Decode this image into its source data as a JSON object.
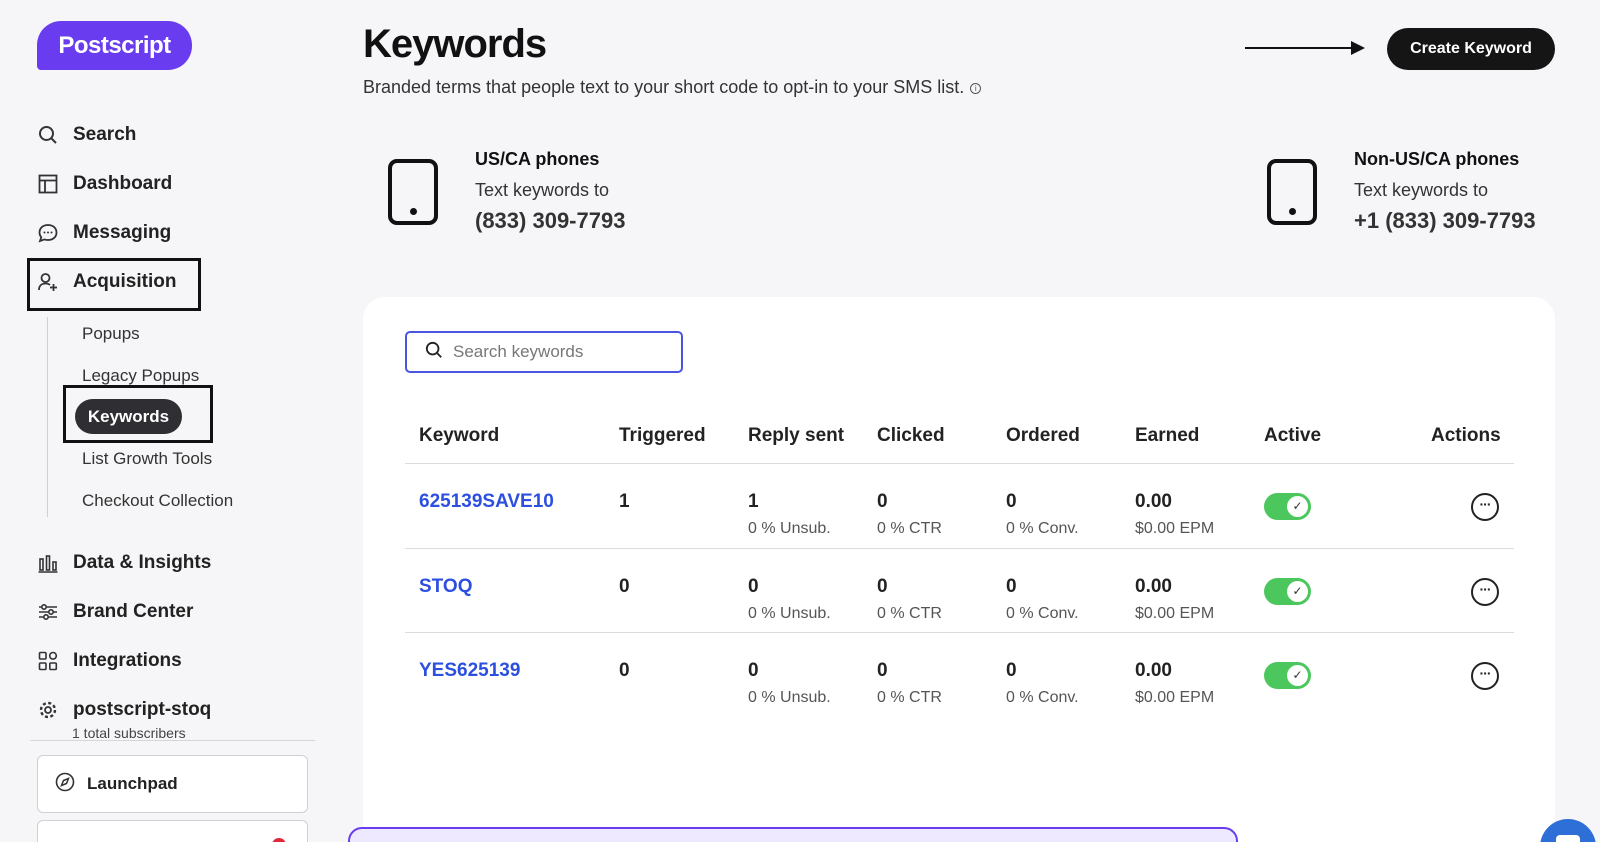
{
  "brand": {
    "logo_text": "Postscript",
    "accent": "#6a3cf0"
  },
  "nav": {
    "items": [
      {
        "label": "Search",
        "icon": "search-icon"
      },
      {
        "label": "Dashboard",
        "icon": "dashboard-icon"
      },
      {
        "label": "Messaging",
        "icon": "chat-icon"
      },
      {
        "label": "Acquisition",
        "icon": "user-plus-icon"
      }
    ],
    "acquisition_sub": [
      "Popups",
      "Legacy Popups",
      "Keywords",
      "List Growth Tools",
      "Checkout Collection"
    ],
    "active_sub": "Keywords",
    "lower_items": [
      {
        "label": "Data & Insights",
        "icon": "bar-chart-icon"
      },
      {
        "label": "Brand Center",
        "icon": "sliders-icon"
      },
      {
        "label": "Integrations",
        "icon": "apps-icon"
      }
    ],
    "account": {
      "name": "postscript-stoq",
      "subscribers": "1 total subscribers",
      "icon": "gear-icon"
    },
    "launchpad": {
      "label": "Launchpad",
      "icon": "compass-icon"
    }
  },
  "header": {
    "title": "Keywords",
    "subtitle": "Branded terms that people text to your short code to opt-in to your SMS list.",
    "create_button": "Create Keyword"
  },
  "phones": [
    {
      "title": "US/CA phones",
      "sub": "Text keywords to",
      "number": "(833) 309-7793"
    },
    {
      "title": "Non-US/CA phones",
      "sub": "Text keywords to",
      "number": "+1 (833) 309-7793"
    }
  ],
  "search": {
    "placeholder": "Search keywords",
    "value": ""
  },
  "table": {
    "columns": [
      "Keyword",
      "Triggered",
      "Reply sent",
      "Clicked",
      "Ordered",
      "Earned",
      "Active",
      "Actions"
    ],
    "rows": [
      {
        "keyword": "625139SAVE10",
        "triggered": "1",
        "reply": "1",
        "reply_sub": "0 % Unsub.",
        "clicked": "0",
        "clicked_sub": "0 % CTR",
        "ordered": "0",
        "ordered_sub": "0 % Conv.",
        "earned": "0.00",
        "earned_sub": "$0.00 EPM",
        "active": true
      },
      {
        "keyword": "STOQ",
        "triggered": "0",
        "reply": "0",
        "reply_sub": "0 % Unsub.",
        "clicked": "0",
        "clicked_sub": "0 % CTR",
        "ordered": "0",
        "ordered_sub": "0 % Conv.",
        "earned": "0.00",
        "earned_sub": "$0.00 EPM",
        "active": true
      },
      {
        "keyword": "YES625139",
        "triggered": "0",
        "reply": "0",
        "reply_sub": "0 % Unsub.",
        "clicked": "0",
        "clicked_sub": "0 % CTR",
        "ordered": "0",
        "ordered_sub": "0 % Conv.",
        "earned": "0.00",
        "earned_sub": "$0.00 EPM",
        "active": true
      }
    ]
  },
  "colors": {
    "toggle_on": "#4cc75e",
    "link": "#2c4fe0"
  }
}
